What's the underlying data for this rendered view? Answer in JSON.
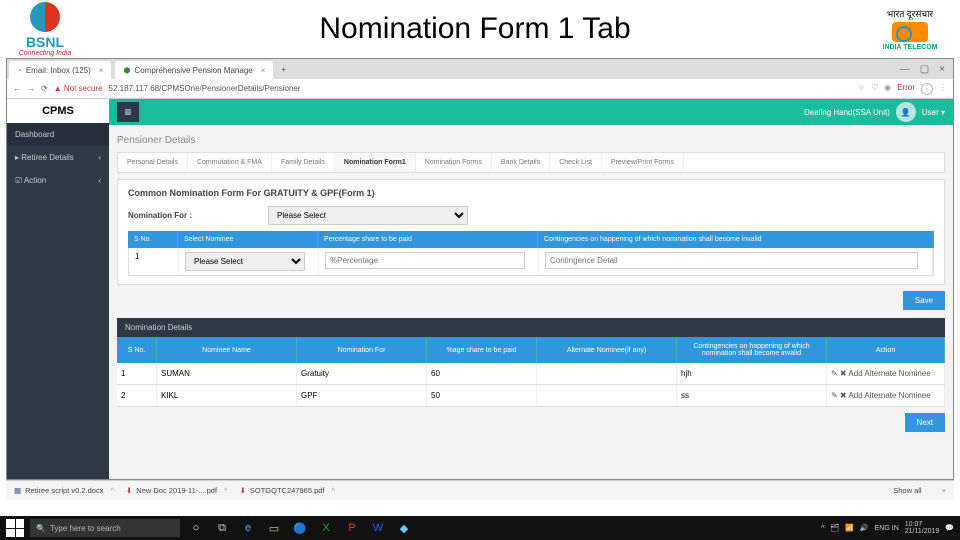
{
  "slide": {
    "title": "Nomination Form 1 Tab",
    "bsnl": "BSNL",
    "bsnl_tag": "Connecting India",
    "dot_hindi": "भारत दूरसंचार",
    "dot_sub": "INDIA TELECOM"
  },
  "tabs": {
    "t1": "Email: Inbox (125)",
    "t2": "Comprehensive Pension Manage"
  },
  "addr": {
    "warn": "Not secure",
    "url": "52.187.117.68/CPMSOne/PensionerDetails/Pensioner",
    "err": "Error"
  },
  "brand": "CPMS",
  "sidebar": {
    "i0": "Dashboard",
    "i1": "Retiree Details",
    "i2": "Action"
  },
  "topbar": {
    "role": "Dealing Hand(SSA Unit)",
    "user": "User"
  },
  "page": {
    "title": "Pensioner Details"
  },
  "ptabs": {
    "t0": "Personal Details",
    "t1": "Commutation & FMA",
    "t2": "Family Details",
    "t3": "Nomination Form1",
    "t4": "Nomination Forms",
    "t5": "Bank Details",
    "t6": "Check List",
    "t7": "Preview/Print Forms"
  },
  "form": {
    "heading": "Common Nomination Form For GRATUITY & GPF(Form 1)",
    "label_for": "Nomination For :",
    "select_placeholder": "Please Select",
    "th_sno": "S No.",
    "th_sel": "Select Nominee",
    "th_pct": "Percentage share to be paid",
    "th_cont": "Contingencies on happening of which nomination shall become invalid",
    "r1_sno": "1",
    "r1_sel": "Please Select",
    "r1_pct_ph": "%Percentage",
    "r1_cont_ph": "Contingence Detail",
    "save": "Save"
  },
  "list": {
    "title": "Nomination Details",
    "th_sno": "S No.",
    "th_name": "Nominee Name",
    "th_for": "Nomination For",
    "th_pct": "%age share to be paid",
    "th_alt": "Alternate Nominee(if any)",
    "th_cont": "Contingencies on happening of which nomination shall become invalid",
    "th_act": "Action",
    "r1_sno": "1",
    "r1_name": "SUMAN",
    "r1_for": "Gratuity",
    "r1_pct": "60",
    "r1_alt": "",
    "r1_cont": "hjh",
    "r1_act": "✎ ✖ Add Alternate Nominee",
    "r2_sno": "2",
    "r2_name": "KIKL",
    "r2_for": "GPF",
    "r2_pct": "50",
    "r2_alt": "",
    "r2_cont": "ss",
    "r2_act": "✎ ✖ Add Alternate Nominee",
    "next": "Next"
  },
  "downloads": {
    "d1": "Retiree script v0.2.docx",
    "d2": "New Doc 2019-11-....pdf",
    "d3": "SOTGQTC247965.pdf",
    "showall": "Show all"
  },
  "task": {
    "search": "Type here to search",
    "lang": "ENG IN",
    "time": "10:07",
    "date": "21/11/2019"
  }
}
